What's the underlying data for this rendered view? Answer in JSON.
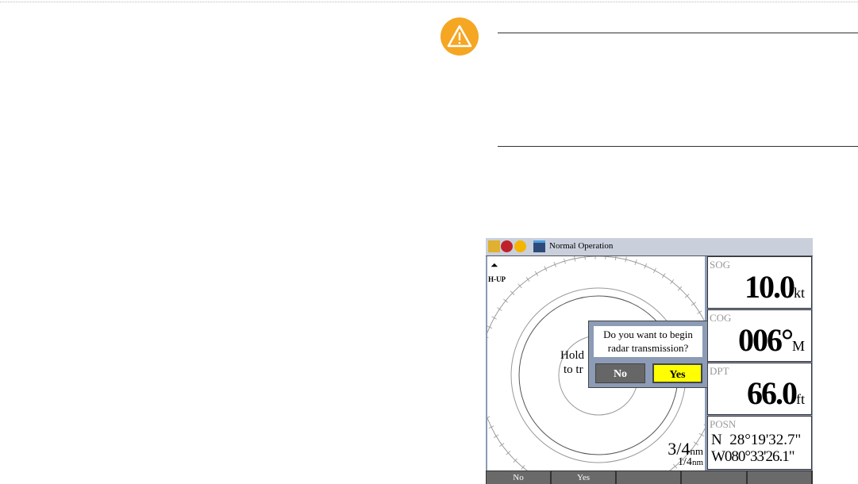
{
  "device": {
    "title": "Normal Operation",
    "orientation": "H-UP",
    "hint_line1": "Hold",
    "hint_line2": "to tr",
    "range_outer": "3/4",
    "range_inner": "1/4",
    "range_unit": "nm",
    "panels": {
      "sog": {
        "label": "SOG",
        "value": "10.0",
        "unit": "kt"
      },
      "cog": {
        "label": "COG",
        "value": "006°",
        "unit": "M"
      },
      "dpt": {
        "label": "DPT",
        "value": "66.0",
        "unit": "ft"
      },
      "posn": {
        "label": "POSN",
        "lat": "N  28°19'32.7\"",
        "lon": "W080°33'26.1\""
      }
    },
    "dialog": {
      "message": "Do you want to begin radar transmission?",
      "no": "No",
      "yes": "Yes"
    },
    "softkeys": [
      "No",
      "Yes",
      "",
      "",
      ""
    ]
  },
  "colors": {
    "warning": "#f5a623",
    "yes": "#ffff00",
    "no": "#666666"
  }
}
